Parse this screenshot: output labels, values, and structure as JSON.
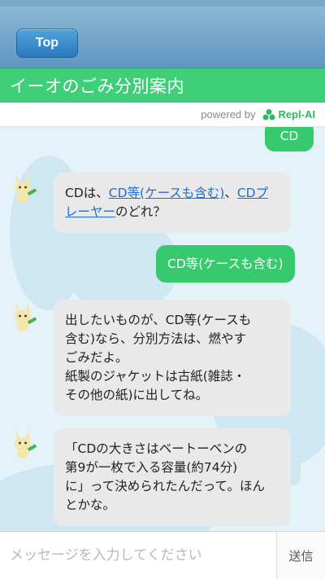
{
  "nav": {
    "back_label": "Top"
  },
  "header": {
    "title": "イーオのごみ分別案内"
  },
  "powered": {
    "text": "powered by",
    "brand": "Repl-AI"
  },
  "messages": [
    {
      "from": "user",
      "text": "CD"
    },
    {
      "from": "bot",
      "prefix": "CDは、",
      "link1": "CD等(ケースも含む)",
      "mid": "、",
      "link2": "CDプレーヤー",
      "suffix": "のどれ？"
    },
    {
      "from": "user",
      "text": "CD等(ケースも含む)"
    },
    {
      "from": "bot",
      "lines": [
        "出したいものが、CD等(ケースも",
        "含む)なら、分別方法は、燃やす",
        "ごみだよ。",
        "紙製のジャケットは古紙(雑誌・",
        "その他の紙)に出してね。"
      ]
    },
    {
      "from": "bot",
      "lines": [
        "「CDの大きさはベートーベンの",
        "第9が一枚で入る容量(約74分)",
        "に」って決められたんだって。ほん",
        "とかな。"
      ]
    }
  ],
  "composer": {
    "placeholder": "メッセージを入力してください",
    "send_label": "送信"
  },
  "colors": {
    "accent": "#3ecf78",
    "user_bubble": "#36c96d",
    "nav": "#5f97c1",
    "link": "#1f6fd0"
  }
}
